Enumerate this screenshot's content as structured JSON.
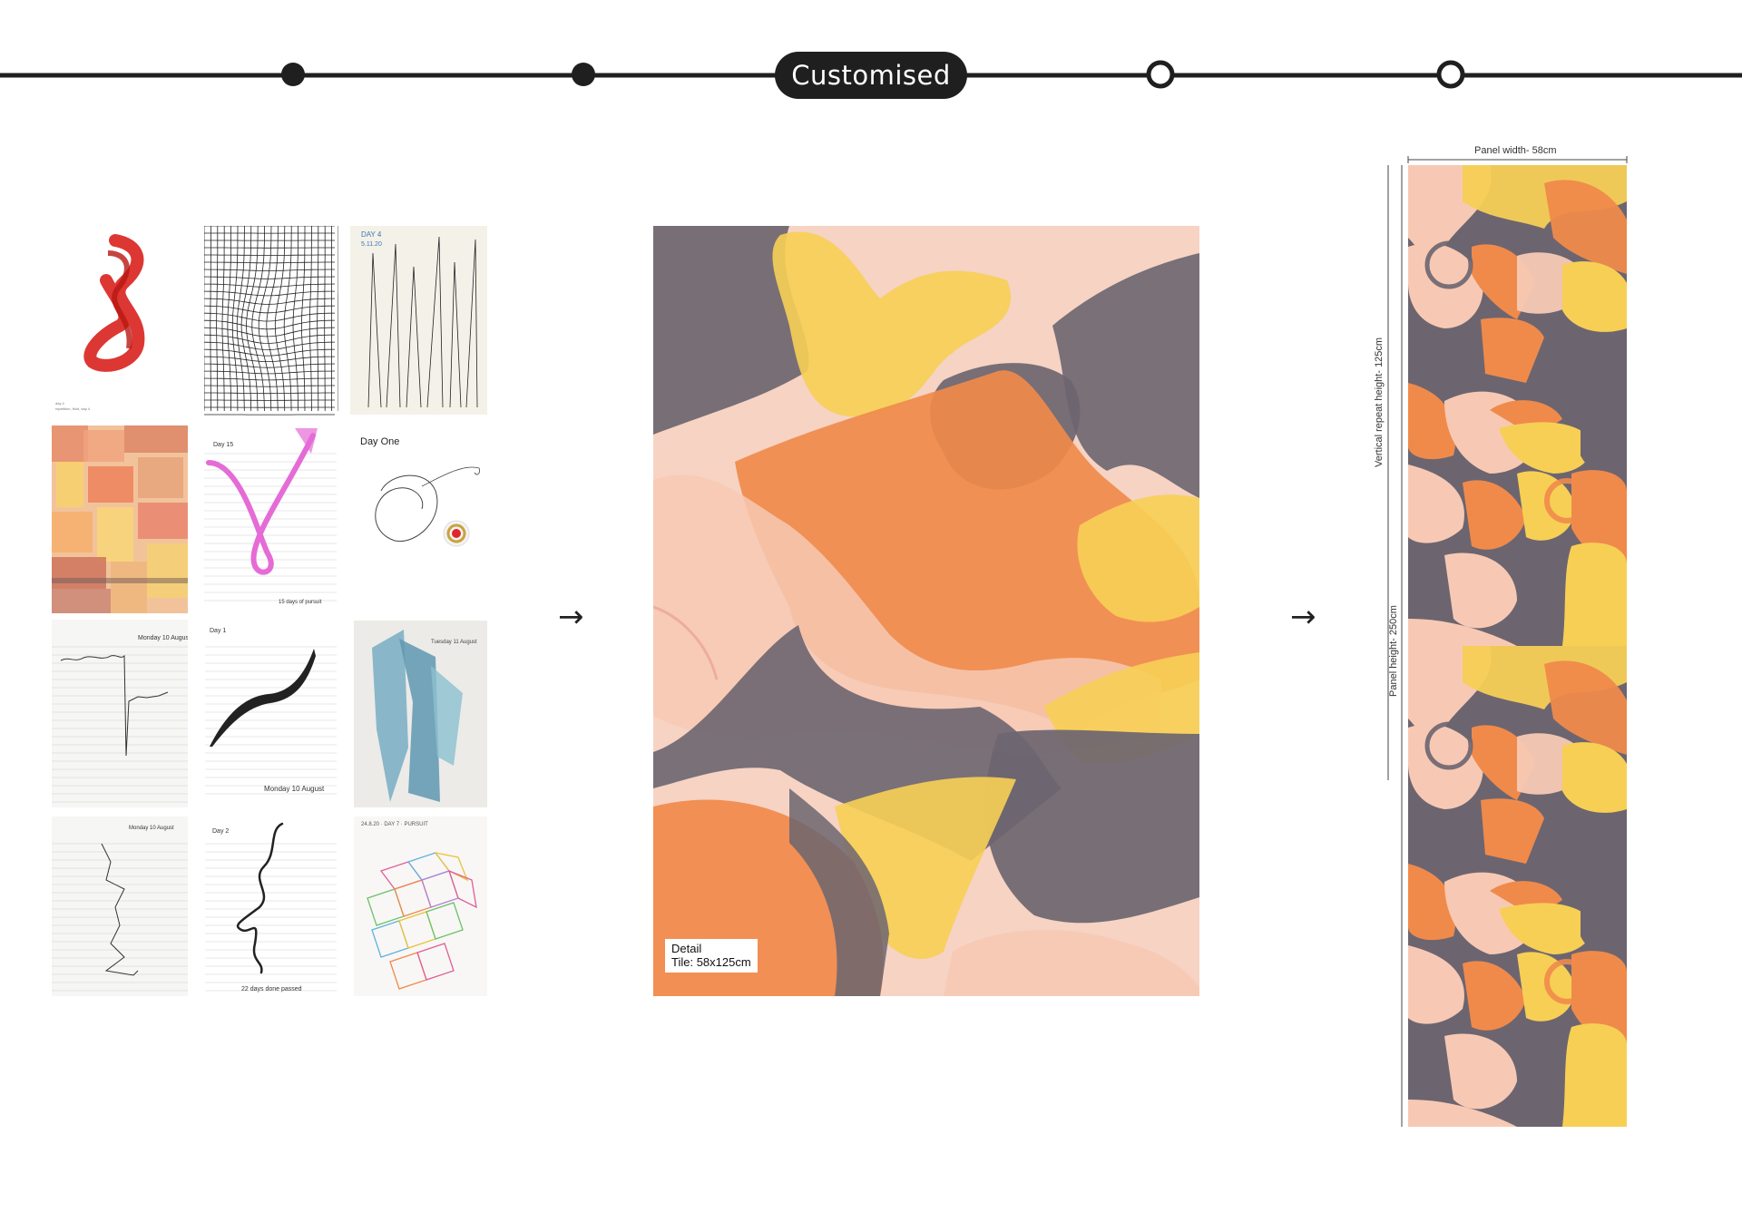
{
  "timeline": {
    "active_step_label": "Customised",
    "steps": [
      {
        "state": "done"
      },
      {
        "state": "done"
      },
      {
        "state": "active"
      },
      {
        "state": "upcoming"
      },
      {
        "state": "upcoming"
      }
    ]
  },
  "sketches": [
    {
      "id": "red-ribbon-sketch"
    },
    {
      "id": "distorted-grid-sketch"
    },
    {
      "id": "day-4-line-sketch",
      "caption": "DAY 4"
    },
    {
      "id": "watercolour-squares-sketch"
    },
    {
      "id": "pink-loop-sketch",
      "caption": "Day 15"
    },
    {
      "id": "day-one-scribble-sketch",
      "caption": "Day One"
    },
    {
      "id": "notebook-jagged-line-sketch"
    },
    {
      "id": "notebook-black-stroke-sketch",
      "caption": "Monday 10 August"
    },
    {
      "id": "blue-shards-sketch"
    },
    {
      "id": "notebook-zigzag-sketch"
    },
    {
      "id": "notebook-squiggle-sketch"
    },
    {
      "id": "coloured-cubes-sketch"
    }
  ],
  "arrows": {
    "first": "→",
    "second": "→"
  },
  "detail": {
    "label_line1": "Detail",
    "label_line2": "Tile: 58x125cm"
  },
  "panel": {
    "width_label": "Panel width- 58cm",
    "repeat_label": "Vertical repeat height- 125cm",
    "height_label": "Panel height- 250cm"
  },
  "colors": {
    "orange": "#f08a4b",
    "peach": "#f7c9b4",
    "grey": "#6c6570",
    "yellow": "#f7cf55",
    "blush": "#fbe2d6"
  }
}
